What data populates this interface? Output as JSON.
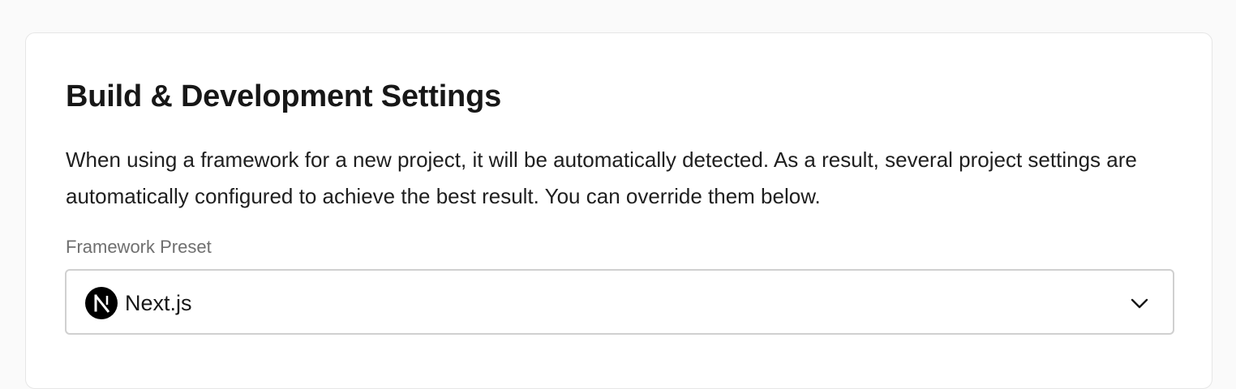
{
  "settings_card": {
    "title": "Build & Development Settings",
    "description": "When using a framework for a new project, it will be automatically detected. As a result, several project settings are automatically configured to achieve the best result. You can override them below.",
    "framework_preset": {
      "label": "Framework Preset",
      "selected_value": "Next.js",
      "icon": "nextjs-logo-icon",
      "dropdown_icon": "chevron-down-icon"
    }
  },
  "colors": {
    "page_background": "#fafafa",
    "card_background": "#ffffff",
    "text_primary": "#171717",
    "text_secondary": "#6f6f6f",
    "border": "#d0d0d0"
  }
}
